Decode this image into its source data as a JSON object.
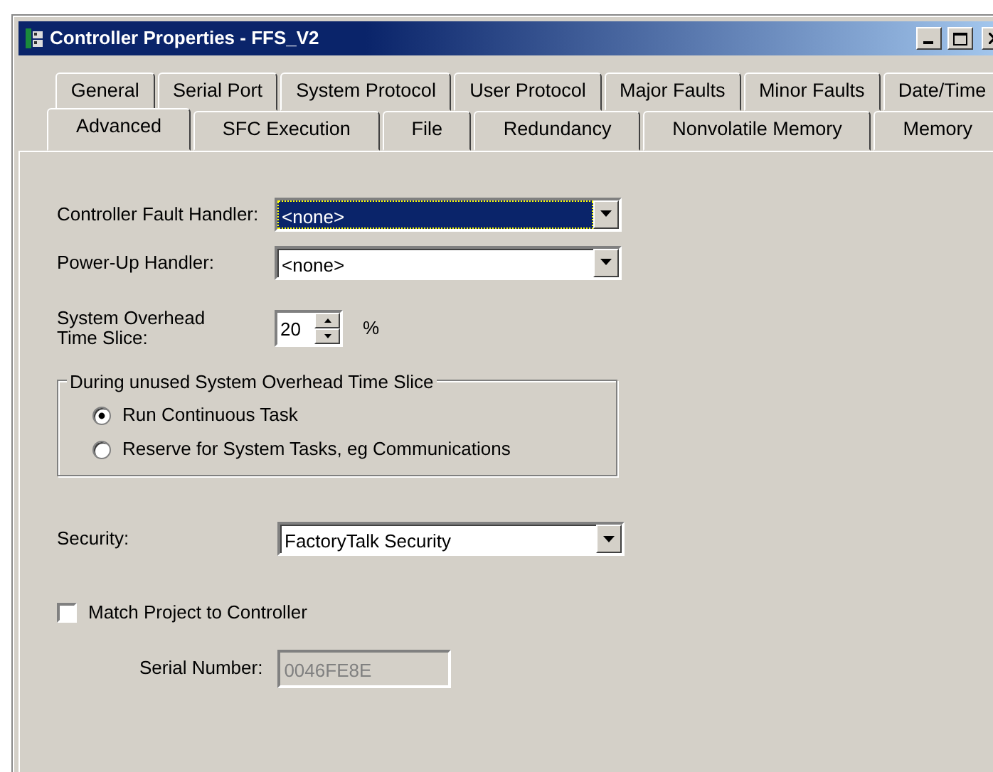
{
  "window": {
    "title": "Controller Properties - FFS_V2"
  },
  "tab_rows": [
    {
      "tabs": [
        {
          "label": "General",
          "selected": false
        },
        {
          "label": "Serial Port",
          "selected": false
        },
        {
          "label": "System Protocol",
          "selected": false
        },
        {
          "label": "User Protocol",
          "selected": false
        },
        {
          "label": "Major Faults",
          "selected": false
        },
        {
          "label": "Minor Faults",
          "selected": false
        },
        {
          "label": "Date/Time",
          "selected": false
        }
      ]
    },
    {
      "tabs": [
        {
          "label": "Advanced",
          "selected": true
        },
        {
          "label": "SFC Execution",
          "selected": false
        },
        {
          "label": "File",
          "selected": false
        },
        {
          "label": "Redundancy",
          "selected": false
        },
        {
          "label": "Nonvolatile Memory",
          "selected": false
        },
        {
          "label": "Memory",
          "selected": false
        }
      ]
    }
  ],
  "fault_handler": {
    "label": "Controller Fault Handler:",
    "value": "<none>",
    "highlighted": true
  },
  "power_up_handler": {
    "label": "Power-Up Handler:",
    "value": "<none>",
    "highlighted": false
  },
  "overhead": {
    "label": "System Overhead Time Slice:",
    "value": "20",
    "unit": "%"
  },
  "unused_group": {
    "title": "During unused System Overhead Time Slice",
    "options": [
      {
        "label": "Run Continuous Task",
        "selected": true
      },
      {
        "label": "Reserve for System Tasks, eg Communications",
        "selected": false
      }
    ]
  },
  "security": {
    "label": "Security:",
    "value": "FactoryTalk Security",
    "highlighted": false
  },
  "match_project": {
    "label": "Match Project to Controller",
    "checked": false
  },
  "serial_number": {
    "label": "Serial Number:",
    "value": "0046FE8E",
    "disabled": true
  }
}
